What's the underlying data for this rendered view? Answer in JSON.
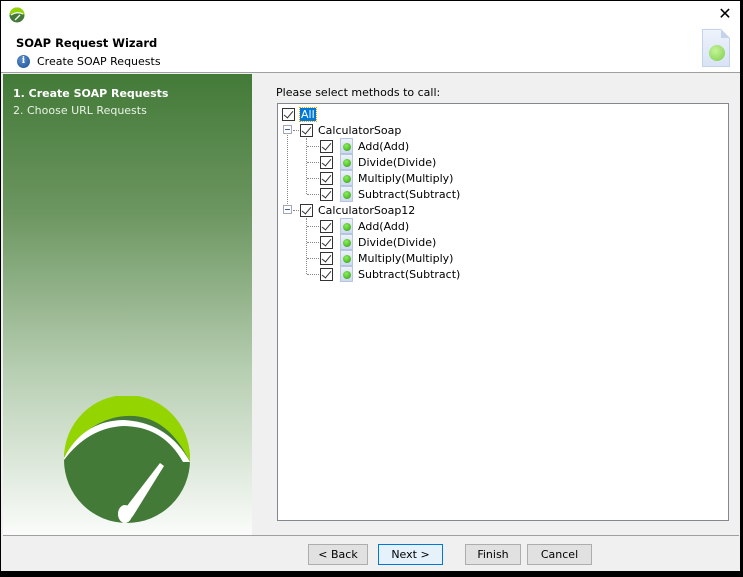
{
  "window": {
    "title": "SOAP Request Wizard",
    "subtitle": "Create SOAP Requests",
    "close_icon": "close-icon"
  },
  "steps": [
    {
      "label": "1. Create SOAP Requests",
      "active": true
    },
    {
      "label": "2. Choose URL Requests",
      "active": false
    }
  ],
  "main": {
    "prompt": "Please select methods to call:",
    "tree": {
      "root": {
        "label": "All",
        "checked": true
      },
      "services": [
        {
          "label": "CalculatorSoap",
          "checked": true,
          "methods": [
            "Add(Add)",
            "Divide(Divide)",
            "Multiply(Multiply)",
            "Subtract(Subtract)"
          ]
        },
        {
          "label": "CalculatorSoap12",
          "checked": true,
          "methods": [
            "Add(Add)",
            "Divide(Divide)",
            "Multiply(Multiply)",
            "Subtract(Subtract)"
          ]
        }
      ]
    }
  },
  "buttons": {
    "back": "< Back",
    "next": "Next >",
    "finish": "Finish",
    "cancel": "Cancel"
  },
  "colors": {
    "accent": "#0078d7",
    "panel_green": "#437a38",
    "logo_lime": "#94d400"
  }
}
